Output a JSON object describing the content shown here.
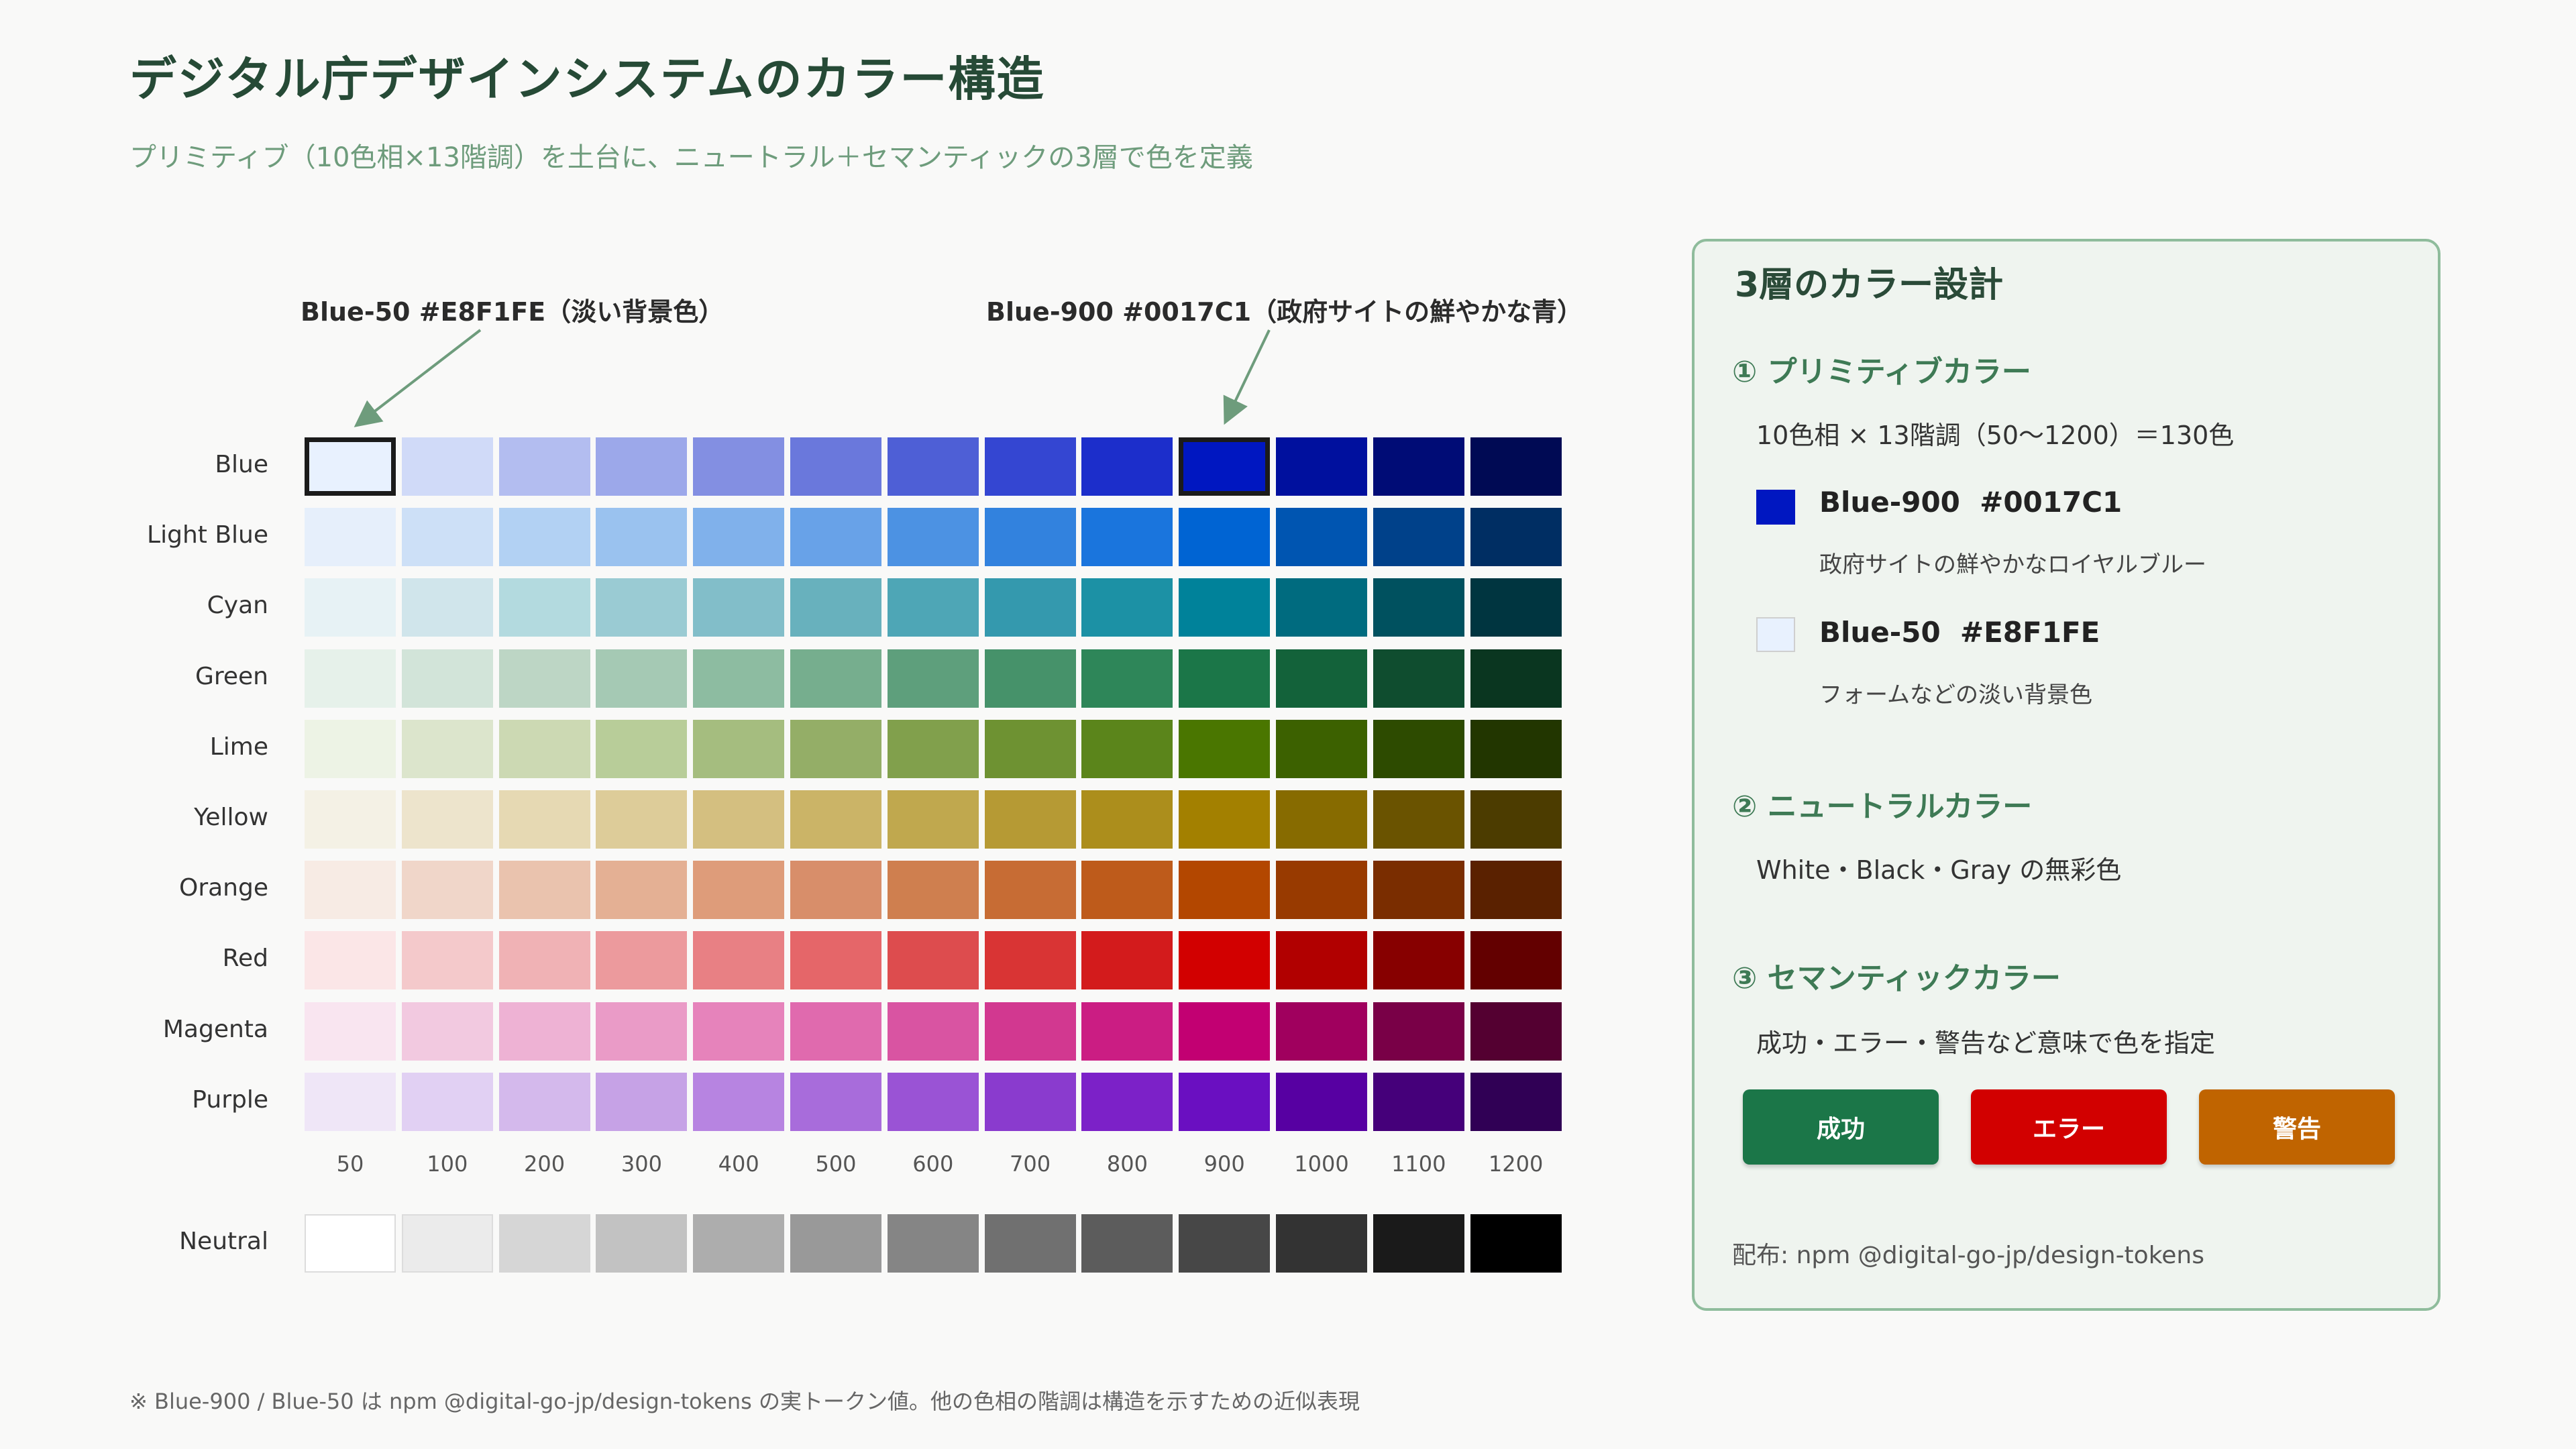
{
  "title": "デジタル庁デザインシステムのカラー構造",
  "subtitle": "プリミティブ（10色相×13階調）を土台に、ニュートラル＋セマンティックの3層で色を定義",
  "callouts": {
    "blue50": "Blue-50 #E8F1FE（淡い背景色）",
    "blue900": "Blue-900 #0017C1（政府サイトの鮮やかな青）"
  },
  "steps": [
    "50",
    "100",
    "200",
    "300",
    "400",
    "500",
    "600",
    "700",
    "800",
    "900",
    "1000",
    "1100",
    "1200"
  ],
  "hues": [
    {
      "name": "Blue",
      "colors": [
        "#E8F1FE",
        "#D0DAF8",
        "#B3BDF0",
        "#9CA8EA",
        "#838FE2",
        "#6A78DC",
        "#4E5FD6",
        "#3446D2",
        "#1C2ECB",
        "#0017C1",
        "#00109E",
        "#000C76",
        "#000A54"
      ]
    },
    {
      "name": "Light Blue",
      "colors": [
        "#E6EFFB",
        "#CDE0F7",
        "#B2D1F3",
        "#9AC2EF",
        "#80B1EB",
        "#68A2E8",
        "#4C92E3",
        "#3282DE",
        "#1A75DD",
        "#0064D3",
        "#0055B1",
        "#00418A",
        "#002E63"
      ]
    },
    {
      "name": "Cyan",
      "colors": [
        "#E7F2F5",
        "#D0E5EB",
        "#B3DADF",
        "#9ACBD3",
        "#82BEC9",
        "#68B1BD",
        "#4EA6B6",
        "#3499AE",
        "#1C91A5",
        "#00829A",
        "#006B7F",
        "#00515F",
        "#003540"
      ]
    },
    {
      "name": "Green",
      "colors": [
        "#E6F1EA",
        "#D2E4D9",
        "#BDD6C5",
        "#A5C9B4",
        "#8DBCA1",
        "#76AE8E",
        "#5E9F7C",
        "#46926A",
        "#2E8659",
        "#1B7648",
        "#13623A",
        "#0F4D2F",
        "#0A3620"
      ]
    },
    {
      "name": "Lime",
      "colors": [
        "#EDF3E5",
        "#DCE5CC",
        "#CCD9B3",
        "#B8CD99",
        "#A5BD7F",
        "#94AE67",
        "#81A04C",
        "#6E9232",
        "#5B851B",
        "#4A7600",
        "#3C6100",
        "#2D4B00",
        "#223600"
      ]
    },
    {
      "name": "Yellow",
      "colors": [
        "#F4F1E5",
        "#EDE4CC",
        "#E6D9B3",
        "#DDCC99",
        "#D4BF80",
        "#CBB467",
        "#C0A84E",
        "#B69A34",
        "#AC8E1C",
        "#A38000",
        "#876B00",
        "#6A5300",
        "#4C3C00"
      ]
    },
    {
      "name": "Orange",
      "colors": [
        "#F7EBE4",
        "#F0D6C9",
        "#EAC3AE",
        "#E4B094",
        "#DE9C7A",
        "#D88E6A",
        "#CF7F4F",
        "#C76C34",
        "#BE5B1B",
        "#B34700",
        "#983A00",
        "#7A2D00",
        "#5A2100"
      ]
    },
    {
      "name": "Red",
      "colors": [
        "#FBE6E7",
        "#F4C9CB",
        "#F0B2B5",
        "#EC9A9D",
        "#E88084",
        "#E56669",
        "#DD4C4E",
        "#D93434",
        "#D31B1C",
        "#D20000",
        "#B10000",
        "#870000",
        "#630000"
      ]
    },
    {
      "name": "Magenta",
      "colors": [
        "#F9E5F0",
        "#F2C9E0",
        "#EEB2D4",
        "#EA9BC7",
        "#E683BB",
        "#E06AAE",
        "#D954A2",
        "#D23890",
        "#CB1D83",
        "#C20072",
        "#A0005E",
        "#790047",
        "#540031"
      ]
    },
    {
      "name": "Purple",
      "colors": [
        "#EFE6F7",
        "#E1D0F3",
        "#D4B9EC",
        "#C6A2E6",
        "#B784E1",
        "#A86CDB",
        "#9A53D5",
        "#8A3BCE",
        "#7C21C8",
        "#6A0FC1",
        "#5700A2",
        "#45007A",
        "#300055"
      ]
    }
  ],
  "neutral": {
    "name": "Neutral",
    "colors": [
      "#FFFFFF",
      "#EBEBEB",
      "#D6D6D6",
      "#C2C2C2",
      "#ADADAD",
      "#999999",
      "#858585",
      "#707070",
      "#5C5C5C",
      "#474747",
      "#333333",
      "#1A1A1A",
      "#000000"
    ]
  },
  "panel": {
    "title": "3層のカラー設計",
    "sec1_head": "① プリミティブカラー",
    "sec1_text": "10色相 × 13階調（50〜1200）＝130色",
    "chip1_label": "Blue-900  #0017C1",
    "chip1_color": "#0017C1",
    "chip1_desc": "政府サイトの鮮やかなロイヤルブルー",
    "chip2_label": "Blue-50  #E8F1FE",
    "chip2_color": "#E8F1FE",
    "chip2_desc": "フォームなどの淡い背景色",
    "sec2_head": "② ニュートラルカラー",
    "sec2_text": "White・Black・Gray の無彩色",
    "sec3_head": "③ セマンティックカラー",
    "sec3_text": "成功・エラー・警告など意味で色を指定",
    "buttons": [
      {
        "label": "成功",
        "color": "#1B7648"
      },
      {
        "label": "エラー",
        "color": "#D20000"
      },
      {
        "label": "警告",
        "color": "#C06400"
      }
    ],
    "distribution": "配布: npm  @digital-go-jp/design-tokens"
  },
  "footnote": "※ Blue-900 / Blue-50 は npm @digital-go-jp/design-tokens の実トークン値。他の色相の階調は構造を示すための近似表現"
}
